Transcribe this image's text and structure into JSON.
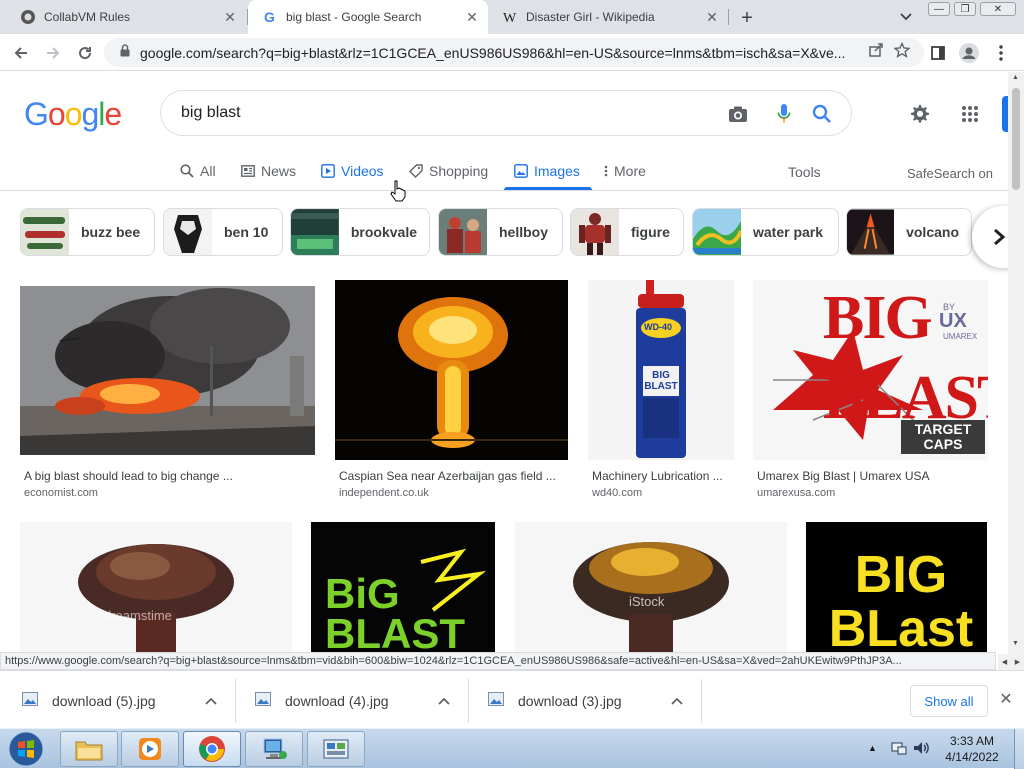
{
  "tabs": [
    {
      "title": "CollabVM Rules",
      "icon": "collabvm-icon"
    },
    {
      "title": "big blast - Google Search",
      "icon": "google-g-icon"
    },
    {
      "title": "Disaster Girl - Wikipedia",
      "icon": "wikipedia-w-icon"
    }
  ],
  "window_controls": {
    "minimize": "—",
    "restore": "❐",
    "close": "✕"
  },
  "omnibox": {
    "url": "google.com/search?q=big+blast&rlz=1C1GCEA_enUS986US986&hl=en-US&source=lnms&tbm=isch&sa=X&ve..."
  },
  "logo": {
    "letters": [
      "G",
      "o",
      "o",
      "g",
      "l",
      "e"
    ],
    "colors": [
      "#4285f4",
      "#ea4335",
      "#fbbc05",
      "#4285f4",
      "#34a853",
      "#ea4335"
    ]
  },
  "search": {
    "query": "big blast"
  },
  "nav": {
    "all": "All",
    "news": "News",
    "videos": "Videos",
    "shopping": "Shopping",
    "images": "Images",
    "more": "More",
    "tools": "Tools",
    "safesearch": "SafeSearch on"
  },
  "chips": [
    {
      "label": "buzz bee",
      "thumb_color": "#5a7a4a"
    },
    {
      "label": "ben 10",
      "thumb_color": "#cfcfcf"
    },
    {
      "label": "brookvale",
      "thumb_color": "#2f6b5a"
    },
    {
      "label": "hellboy",
      "thumb_color": "#a84a3a"
    },
    {
      "label": "figure",
      "thumb_color": "#8a3a3a"
    },
    {
      "label": "water park",
      "thumb_color": "#3a88b8"
    },
    {
      "label": "volcano",
      "thumb_color": "#3a2a2a"
    }
  ],
  "results": [
    {
      "caption": "A big blast should lead to big change ...",
      "source": "economist.com"
    },
    {
      "caption": "Caspian Sea near Azerbaijan gas field ...",
      "source": "independent.co.uk"
    },
    {
      "caption": "Machinery Lubrication ...",
      "source": "wd40.com"
    },
    {
      "caption": "Umarex Big Blast | Umarex USA",
      "source": "umarexusa.com"
    }
  ],
  "image_text": {
    "wd40_brand": "WD-40",
    "wd40_product": "BIG BLAST",
    "umarex_title": "BIG BLAST",
    "umarex_by": "BY",
    "umarex_brand": "UX",
    "umarex_sub": "UMAREX",
    "umarex_tag": "TARGET CAPS",
    "row2_logo2": "BiG BLAST",
    "row2_logo4": "BIG BLast",
    "istock": "iStock",
    "dreamstime": "dreamstime"
  },
  "status_url": "https://www.google.com/search?q=big+blast&source=lnms&tbm=vid&bih=600&biw=1024&rlz=1C1GCEA_enUS986US986&safe=active&hl=en-US&sa=X&ved=2ahUKEwitw9PthJP3A...",
  "downloads": [
    {
      "name": "download (5).jpg"
    },
    {
      "name": "download (4).jpg"
    },
    {
      "name": "download (3).jpg"
    }
  ],
  "show_all": "Show all",
  "clock": {
    "time": "3:33 AM",
    "date": "4/14/2022"
  }
}
